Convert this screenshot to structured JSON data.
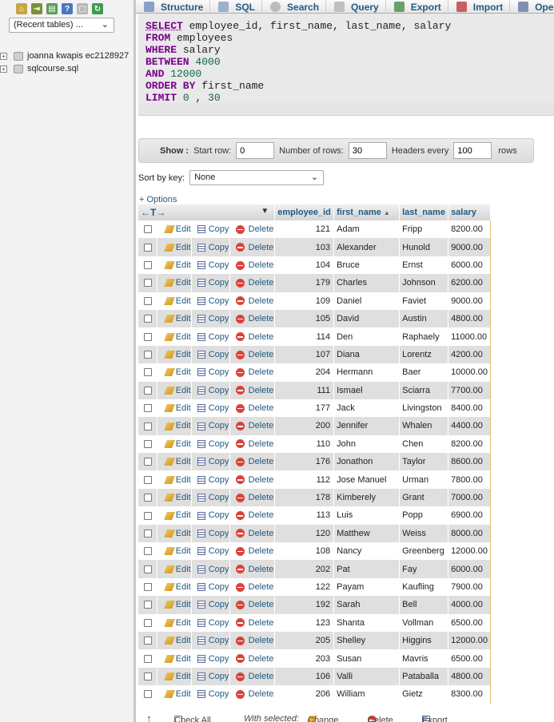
{
  "nav": {
    "recent_tables": "(Recent tables) ...",
    "databases": [
      "joanna kwapis ec2128927",
      "sqlcourse.sql"
    ]
  },
  "tabs": [
    "Structure",
    "SQL",
    "Search",
    "Query",
    "Export",
    "Import",
    "Operations"
  ],
  "sql": {
    "line1_kw": "SELECT",
    "line1_rest": " employee_id, first_name, last_name, salary",
    "line2_kw": "FROM",
    "line2_rest": " employees",
    "line3_kw": "WHERE",
    "line3_rest": " salary",
    "line4_kw": "BETWEEN",
    "line4_num": " 4000",
    "line5_kw": "AND",
    "line5_num": " 12000",
    "line6_kw": "ORDER BY",
    "line6_rest": " first_name",
    "line7_kw": "LIMIT",
    "line7_num1": " 0",
    "line7_sep": " , ",
    "line7_num2": "30"
  },
  "show": {
    "show_label": "Show :",
    "start_row_label": "Start row:",
    "start_row_value": "0",
    "num_rows_label": "Number of rows:",
    "num_rows_value": "30",
    "headers_label": "Headers every",
    "headers_value": "100",
    "rows_label": "rows"
  },
  "sort": {
    "label": "Sort by key:",
    "value": "None"
  },
  "options_link": "+ Options",
  "table": {
    "columns": [
      "employee_id",
      "first_name",
      "last_name",
      "salary"
    ],
    "actions": {
      "edit": "Edit",
      "copy": "Copy",
      "delete": "Delete"
    },
    "rows": [
      [
        "121",
        "Adam",
        "Fripp",
        "8200.00"
      ],
      [
        "103",
        "Alexander",
        "Hunold",
        "9000.00"
      ],
      [
        "104",
        "Bruce",
        "Ernst",
        "6000.00"
      ],
      [
        "179",
        "Charles",
        "Johnson",
        "6200.00"
      ],
      [
        "109",
        "Daniel",
        "Faviet",
        "9000.00"
      ],
      [
        "105",
        "David",
        "Austin",
        "4800.00"
      ],
      [
        "114",
        "Den",
        "Raphaely",
        "11000.00"
      ],
      [
        "107",
        "Diana",
        "Lorentz",
        "4200.00"
      ],
      [
        "204",
        "Hermann",
        "Baer",
        "10000.00"
      ],
      [
        "111",
        "Ismael",
        "Sciarra",
        "7700.00"
      ],
      [
        "177",
        "Jack",
        "Livingston",
        "8400.00"
      ],
      [
        "200",
        "Jennifer",
        "Whalen",
        "4400.00"
      ],
      [
        "110",
        "John",
        "Chen",
        "8200.00"
      ],
      [
        "176",
        "Jonathon",
        "Taylor",
        "8600.00"
      ],
      [
        "112",
        "Jose Manuel",
        "Urman",
        "7800.00"
      ],
      [
        "178",
        "Kimberely",
        "Grant",
        "7000.00"
      ],
      [
        "113",
        "Luis",
        "Popp",
        "6900.00"
      ],
      [
        "120",
        "Matthew",
        "Weiss",
        "8000.00"
      ],
      [
        "108",
        "Nancy",
        "Greenberg",
        "12000.00"
      ],
      [
        "202",
        "Pat",
        "Fay",
        "6000.00"
      ],
      [
        "122",
        "Payam",
        "Kaufling",
        "7900.00"
      ],
      [
        "192",
        "Sarah",
        "Bell",
        "4000.00"
      ],
      [
        "123",
        "Shanta",
        "Vollman",
        "6500.00"
      ],
      [
        "205",
        "Shelley",
        "Higgins",
        "12000.00"
      ],
      [
        "203",
        "Susan",
        "Mavris",
        "6500.00"
      ],
      [
        "106",
        "Valli",
        "Pataballa",
        "4800.00"
      ],
      [
        "206",
        "William",
        "Gietz",
        "8300.00"
      ]
    ]
  },
  "bottom": {
    "check_all": "Check All",
    "with_selected": "With selected:",
    "change": "Change",
    "delete": "Delete",
    "export": "Export"
  }
}
